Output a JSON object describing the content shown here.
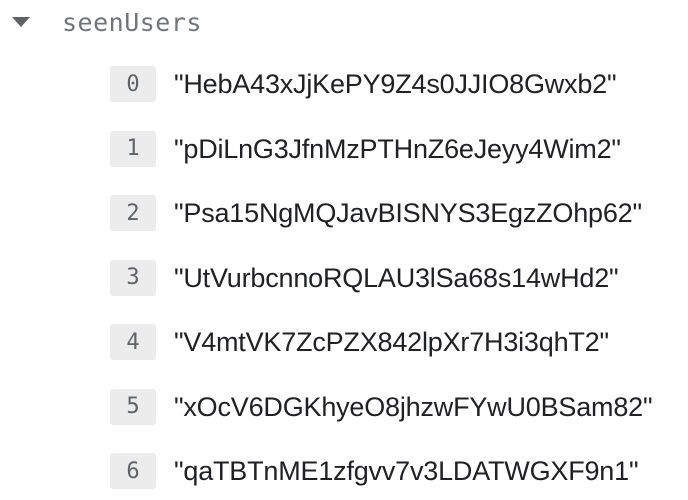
{
  "field": {
    "name": "seenUsers",
    "caret_icon": "chevron-down-icon"
  },
  "items": [
    {
      "index": "0",
      "value": "\"HebA43xJjKePY9Z4s0JJIO8Gwxb2\""
    },
    {
      "index": "1",
      "value": "\"pDiLnG3JfnMzPTHnZ6eJeyy4Wim2\""
    },
    {
      "index": "2",
      "value": "\"Psa15NgMQJavBISNYS3EgzZOhp62\""
    },
    {
      "index": "3",
      "value": "\"UtVurbcnnoRQLAU3lSa68s14wHd2\""
    },
    {
      "index": "4",
      "value": "\"V4mtVK7ZcPZX842lpXr7H3i3qhT2\""
    },
    {
      "index": "5",
      "value": "\"xOcV6DGKhyeO8jhzwFYwU0BSam82\""
    },
    {
      "index": "6",
      "value": "\"qaTBTnME1zfgvv7v3LDATWGXF9n1\""
    }
  ]
}
